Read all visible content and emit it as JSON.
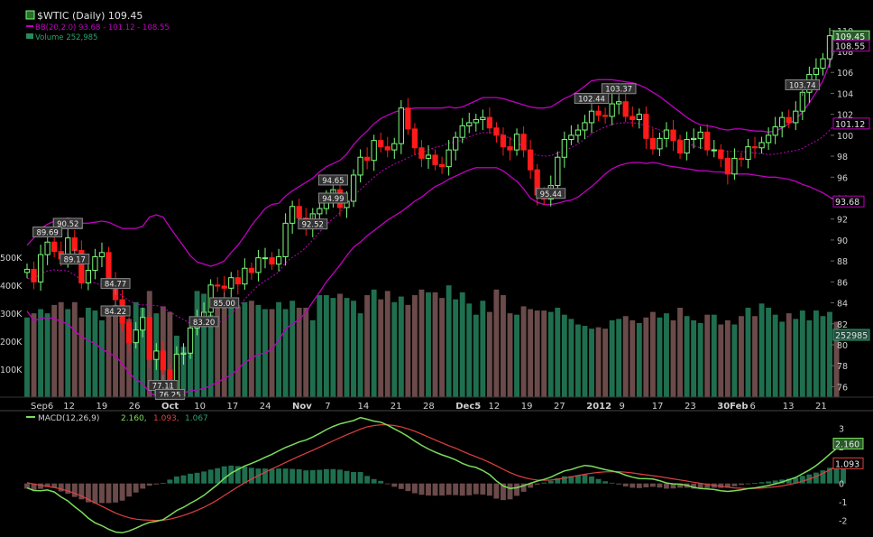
{
  "colors": {
    "background": "#000000",
    "up": "#7cfc7c",
    "down": "#ff1a1a",
    "bollinger": "#c000c0",
    "sma": "#c000c0",
    "volume_up": "#1f6f4f",
    "volume_down": "#6b4a4a",
    "macd_line": "#7cdc5c",
    "signal_line": "#e04040",
    "hist_pos": "#1f6f4f",
    "hist_neg": "#6b4a4a",
    "text": "#cfcfcf",
    "grid_text": "#d0d0d0"
  },
  "legend": {
    "title": "$WTIC (Daily) 109.45",
    "bb": "BB(20,2.0) 93.68 - 101.12 - 108.55",
    "volume": "Volume 252,985",
    "macd_name": "MACD(12,26,9)",
    "macd_val": "2.160,",
    "signal_val": "1.093,",
    "hist_val": "1.067"
  },
  "chart_data": [
    {
      "type": "candlestick",
      "title": "$WTIC (Daily) 109.45",
      "ylim": [
        75,
        110.5
      ],
      "y_ticks": [
        "76",
        "78",
        "80",
        "82",
        "84",
        "86",
        "88",
        "90",
        "92",
        "94",
        "96",
        "98",
        "100",
        "102",
        "104",
        "106",
        "108",
        "110"
      ],
      "x_tick_labels": [
        "Sep6",
        "12",
        "19",
        "26",
        "Oct",
        "10",
        "17",
        "24",
        "Nov",
        "7",
        "14",
        "21",
        "28",
        "Dec5",
        "12",
        "19",
        "27",
        "2012",
        "9",
        "17",
        "23",
        "30Feb",
        "6",
        "13",
        "21"
      ],
      "bold_x_ticks": [
        "Oct",
        "Nov",
        "Dec",
        "2012",
        "Feb"
      ],
      "right_labels": {
        "last": "109.45",
        "upper_band": "108.55",
        "middle_band": "101.12",
        "lower_band": "93.68",
        "volume": "252985"
      },
      "annotations": [
        {
          "text": "90.48",
          "value": 90.48,
          "pos": "above"
        },
        {
          "text": "90.52",
          "value": 90.52,
          "pos": "above"
        },
        {
          "text": "83.20",
          "value": 83.2,
          "pos": "below"
        },
        {
          "text": "85.00",
          "value": 85.0,
          "pos": "below"
        },
        {
          "text": "84.77",
          "value": 84.77,
          "pos": "above"
        },
        {
          "text": "77.11",
          "value": 77.11,
          "pos": "below"
        },
        {
          "text": "76.25",
          "value": 76.25,
          "pos": "below"
        },
        {
          "text": "89.69",
          "value": 89.69,
          "pos": "above"
        },
        {
          "text": "84.22",
          "value": 84.22,
          "pos": "below"
        },
        {
          "text": "94.65",
          "value": 94.65,
          "pos": "above"
        },
        {
          "text": "89.17",
          "value": 89.17,
          "pos": "below"
        },
        {
          "text": "103.37",
          "value": 103.37,
          "pos": "above"
        },
        {
          "text": "94.99",
          "value": 94.99,
          "pos": "below"
        },
        {
          "text": "102.44",
          "value": 102.44,
          "pos": "above"
        },
        {
          "text": "92.52",
          "value": 92.52,
          "pos": "below"
        },
        {
          "text": "103.74",
          "value": 103.74,
          "pos": "above"
        },
        {
          "text": "95.44",
          "value": 95.44,
          "pos": "below"
        }
      ],
      "close": [
        87.2,
        86.0,
        88.6,
        89.8,
        88.9,
        88.2,
        90.2,
        89.0,
        85.9,
        87.1,
        88.4,
        88.8,
        86.2,
        84.3,
        82.1,
        80.2,
        81.4,
        82.6,
        78.6,
        79.4,
        77.6,
        75.7,
        79.1,
        79.2,
        81.6,
        82.6,
        83.1,
        85.7,
        85.6,
        85.4,
        86.4,
        85.8,
        87.3,
        86.9,
        88.3,
        88.3,
        87.7,
        88.4,
        91.6,
        93.2,
        92.1,
        91.1,
        92.5,
        93.0,
        93.8,
        94.8,
        93.1,
        93.7,
        96.2,
        97.9,
        97.6,
        99.5,
        98.9,
        98.6,
        99.2,
        102.6,
        100.6,
        98.8,
        97.8,
        98.1,
        97.2,
        97.0,
        98.6,
        99.8,
        100.9,
        101.2,
        101.5,
        101.7,
        100.7,
        100.0,
        98.9,
        98.6,
        100.1,
        98.6,
        96.7,
        94.3,
        93.9,
        95.2,
        97.9,
        99.6,
        100.0,
        100.5,
        101.2,
        102.3,
        101.9,
        101.8,
        103.0,
        103.2,
        101.8,
        101.5,
        102.0,
        99.7,
        98.7,
        99.7,
        100.5,
        99.5,
        98.3,
        99.6,
        99.7,
        100.3,
        98.6,
        98.6,
        97.8,
        96.3,
        97.8,
        97.7,
        98.9,
        98.8,
        99.3,
        100.0,
        100.8,
        101.7,
        101.2,
        102.3,
        104.1,
        105.8,
        106.4,
        107.3,
        109.5
      ],
      "volume": [
        285,
        300,
        315,
        300,
        330,
        340,
        315,
        340,
        285,
        320,
        310,
        275,
        305,
        330,
        325,
        280,
        340,
        320,
        380,
        300,
        325,
        305,
        220,
        180,
        160,
        380,
        370,
        295,
        345,
        325,
        320,
        325,
        340,
        345,
        330,
        315,
        315,
        340,
        315,
        345,
        320,
        320,
        275,
        365,
        365,
        355,
        370,
        355,
        345,
        300,
        365,
        385,
        350,
        380,
        340,
        360,
        330,
        365,
        385,
        375,
        375,
        355,
        400,
        350,
        375,
        335,
        295,
        345,
        305,
        385,
        365,
        300,
        295,
        325,
        315,
        310,
        310,
        305,
        320,
        295,
        280,
        260,
        255,
        245,
        250,
        245,
        275,
        280,
        290,
        275,
        265,
        285,
        305,
        285,
        300,
        275,
        320,
        290,
        275,
        265,
        295,
        295,
        260,
        275,
        260,
        290,
        320,
        290,
        335,
        320,
        295,
        270,
        300,
        280,
        310,
        275,
        310,
        290,
        305,
        270
      ],
      "macd": [
        -0.24,
        -0.38,
        -0.39,
        -0.35,
        -0.46,
        -0.73,
        -0.95,
        -1.26,
        -1.54,
        -1.88,
        -2.13,
        -2.29,
        -2.48,
        -2.63,
        -2.67,
        -2.57,
        -2.42,
        -2.25,
        -2.11,
        -2.05,
        -1.96,
        -1.72,
        -1.46,
        -1.29,
        -1.07,
        -0.87,
        -0.64,
        -0.35,
        -0.06,
        0.28,
        0.56,
        0.76,
        0.95,
        1.09,
        1.24,
        1.42,
        1.58,
        1.77,
        1.95,
        2.1,
        2.25,
        2.35,
        2.52,
        2.71,
        2.92,
        3.09,
        3.23,
        3.32,
        3.41,
        3.57,
        3.48,
        3.38,
        3.32,
        3.16,
        2.96,
        2.77,
        2.55,
        2.3,
        2.07,
        1.87,
        1.7,
        1.55,
        1.43,
        1.28,
        1.09,
        0.95,
        0.87,
        0.7,
        0.48,
        0.14,
        -0.13,
        -0.27,
        -0.23,
        -0.12,
        0.01,
        0.13,
        0.22,
        0.34,
        0.52,
        0.68,
        0.76,
        0.88,
        0.98,
        0.94,
        0.84,
        0.75,
        0.68,
        0.59,
        0.45,
        0.34,
        0.27,
        0.26,
        0.24,
        0.15,
        0.03,
        -0.02,
        -0.04,
        -0.1,
        -0.21,
        -0.27,
        -0.3,
        -0.33,
        -0.39,
        -0.43,
        -0.39,
        -0.34,
        -0.28,
        -0.24,
        -0.18,
        -0.11,
        -0.02,
        0.08,
        0.2,
        0.33,
        0.53,
        0.73,
        0.97,
        1.26,
        1.59,
        1.89,
        2.16
      ],
      "signal": [
        0.04,
        -0.03,
        -0.1,
        -0.16,
        -0.22,
        -0.3,
        -0.4,
        -0.53,
        -0.68,
        -0.86,
        -1.05,
        -1.23,
        -1.42,
        -1.6,
        -1.74,
        -1.86,
        -1.93,
        -1.97,
        -1.99,
        -2.0,
        -1.99,
        -1.93,
        -1.84,
        -1.73,
        -1.6,
        -1.45,
        -1.29,
        -1.1,
        -0.89,
        -0.65,
        -0.41,
        -0.18,
        0.04,
        0.24,
        0.43,
        0.61,
        0.79,
        0.96,
        1.14,
        1.31,
        1.48,
        1.64,
        1.8,
        1.97,
        2.14,
        2.31,
        2.48,
        2.64,
        2.79,
        2.95,
        3.07,
        3.14,
        3.18,
        3.18,
        3.14,
        3.07,
        2.96,
        2.83,
        2.68,
        2.52,
        2.36,
        2.2,
        2.05,
        1.91,
        1.75,
        1.59,
        1.45,
        1.3,
        1.14,
        0.96,
        0.77,
        0.59,
        0.44,
        0.33,
        0.24,
        0.19,
        0.17,
        0.19,
        0.23,
        0.29,
        0.36,
        0.43,
        0.5,
        0.56,
        0.6,
        0.63,
        0.64,
        0.64,
        0.61,
        0.57,
        0.52,
        0.47,
        0.42,
        0.37,
        0.31,
        0.25,
        0.19,
        0.13,
        0.07,
        0.01,
        -0.05,
        -0.1,
        -0.15,
        -0.2,
        -0.24,
        -0.26,
        -0.27,
        -0.27,
        -0.25,
        -0.22,
        -0.18,
        -0.13,
        -0.06,
        0.02,
        0.12,
        0.24,
        0.38,
        0.55,
        0.74,
        0.93,
        1.09
      ],
      "bb_upper": [
        89.5,
        90.2,
        91.1,
        91.5,
        91.8,
        92.0,
        92.1,
        92.0,
        91.6,
        91.6,
        91.7,
        91.8,
        91.7,
        91.4,
        91.1,
        91.1,
        91.1,
        91.3,
        92.2,
        92.4,
        92.2,
        91.2,
        90.3,
        89.4,
        88.5,
        87.9,
        87.7,
        87.5,
        87.7,
        88.0,
        88.8,
        89.5,
        90.4,
        91.4,
        92.2,
        93.0,
        93.4,
        93.5,
        94.2,
        94.7,
        95.1,
        95.5,
        95.9,
        96.5,
        97.0,
        97.3,
        97.6,
        98.2,
        99.1,
        99.8,
        100.4,
        101.1,
        101.6,
        101.9,
        102.2,
        102.4,
        102.5,
        102.6,
        102.6,
        102.6,
        102.6,
        102.6,
        102.7,
        102.6,
        102.7,
        103.0,
        103.3,
        103.6,
        103.6,
        103.6,
        103.5,
        103.3,
        103.1,
        102.9,
        102.7,
        102.6,
        102.6,
        102.7,
        103.1,
        103.5,
        103.8,
        104.2,
        104.7,
        105.2,
        105.3,
        105.3,
        105.3,
        105.2,
        105.1,
        105.0,
        104.8,
        104.5,
        104.1,
        103.7,
        103.2,
        102.7,
        102.2,
        101.7,
        101.3,
        101.0,
        100.9,
        100.8,
        100.6,
        100.5,
        100.6,
        100.6,
        100.5,
        100.4,
        100.4,
        100.3,
        100.4,
        100.7,
        101.1,
        101.5,
        102.2,
        103.1,
        104.1,
        105.2,
        106.9,
        108.6
      ],
      "bb_lower": [
        83.2,
        82.3,
        82.5,
        82.6,
        82.5,
        82.2,
        82.0,
        81.3,
        80.8,
        80.4,
        80.1,
        79.6,
        79.2,
        78.9,
        78.2,
        77.3,
        76.7,
        76.3,
        75.4,
        75.1,
        74.9,
        75.1,
        75.2,
        75.4,
        75.6,
        75.7,
        75.8,
        76.1,
        76.4,
        76.8,
        77.1,
        77.7,
        78.3,
        78.7,
        79.1,
        79.2,
        79.6,
        80.4,
        81.5,
        82.0,
        82.4,
        83.1,
        84.1,
        85.0,
        86.0,
        86.8,
        87.6,
        88.5,
        89.3,
        89.8,
        90.4,
        90.9,
        91.4,
        91.9,
        92.3,
        92.7,
        93.2,
        93.7,
        94.1,
        94.6,
        95.1,
        95.4,
        95.8,
        96.1,
        96.4,
        96.7,
        96.9,
        96.9,
        96.9,
        96.9,
        96.6,
        96.1,
        95.6,
        94.9,
        94.0,
        93.6,
        93.4,
        93.4,
        93.5,
        93.7,
        93.8,
        94.1,
        94.6,
        95.1,
        95.7,
        96.3,
        96.8,
        97.1,
        97.3,
        97.4,
        97.4,
        97.3,
        97.4,
        97.3,
        97.1,
        97.0,
        96.9,
        96.8,
        96.7,
        96.6,
        96.6,
        96.5,
        96.5,
        96.4,
        96.3,
        96.3,
        96.3,
        96.2,
        96.1,
        96.0,
        96.0,
        95.9,
        95.8,
        95.6,
        95.3,
        95.1,
        94.8,
        94.5,
        94.1,
        93.7
      ]
    }
  ]
}
